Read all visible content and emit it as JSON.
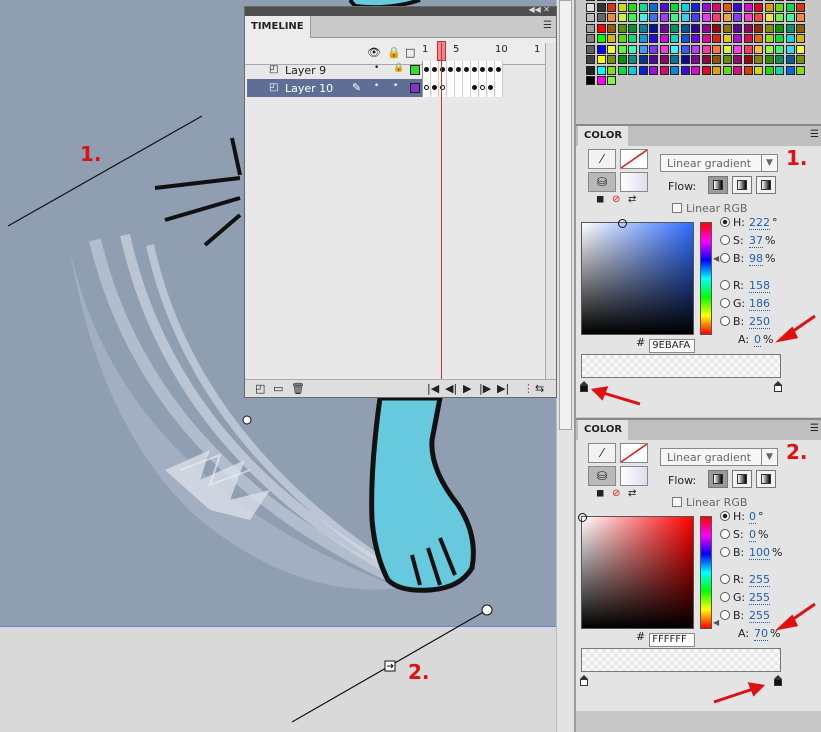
{
  "timeline": {
    "title": "TIMELINE",
    "frame_numbers": [
      "1",
      "5",
      "10",
      "1"
    ],
    "layers": [
      {
        "name": "Layer 9",
        "color": "#33dd33",
        "selected": false
      },
      {
        "name": "Layer 10",
        "color": "#8833cc",
        "selected": true
      }
    ]
  },
  "color_panel_1": {
    "title": "COLOR",
    "type": "Linear gradient",
    "flow_label": "Flow:",
    "linear_rgb": "Linear RGB",
    "hsb": {
      "h": "222",
      "s": "37",
      "b": "98"
    },
    "rgb": {
      "r": "158",
      "g": "186",
      "b": "250"
    },
    "alpha": "0",
    "hex": "9EBAFA",
    "hue_color": "#2f6cff",
    "annotation": "1."
  },
  "color_panel_2": {
    "title": "COLOR",
    "type": "Linear gradient",
    "flow_label": "Flow:",
    "linear_rgb": "Linear RGB",
    "hsb": {
      "h": "0",
      "s": "0",
      "b": "100"
    },
    "rgb": {
      "r": "255",
      "g": "255",
      "b": "255"
    },
    "alpha": "70",
    "hex": "FFFFFF",
    "hue_color": "#ff0000",
    "annotation": "2."
  },
  "labels": {
    "h": "H:",
    "s": "S:",
    "b": "B:",
    "r": "R:",
    "g": "G:",
    "b2": "B:",
    "a": "A:",
    "deg": "°",
    "pct": "%",
    "hash": "#"
  },
  "stage_annotations": {
    "one": "1.",
    "two": "2."
  },
  "colors": {
    "stage_bg": "#8f9eb1",
    "paw": "#66c9dd",
    "annotation_red": "#e01010"
  }
}
